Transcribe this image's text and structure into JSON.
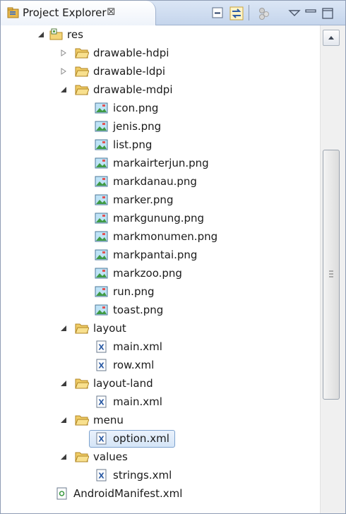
{
  "view": {
    "title": "Project Explorer",
    "close_glyph": "⊠",
    "toolbar": [
      "collapse-all-icon",
      "link-with-editor-icon",
      "focus-task-icon",
      "view-menu-icon",
      "minimize-icon",
      "maximize-icon"
    ]
  },
  "tree": {
    "res": "res",
    "drawable_hdpi": "drawable-hdpi",
    "drawable_ldpi": "drawable-ldpi",
    "drawable_mdpi": "drawable-mdpi",
    "files_mdpi": [
      "icon.png",
      "jenis.png",
      "list.png",
      "markairterjun.png",
      "markdanau.png",
      "marker.png",
      "markgunung.png",
      "markmonumen.png",
      "markpantai.png",
      "markzoo.png",
      "run.png",
      "toast.png"
    ],
    "layout": "layout",
    "layout_files": [
      "main.xml",
      "row.xml"
    ],
    "layout_land": "layout-land",
    "layout_land_files": [
      "main.xml"
    ],
    "menu": "menu",
    "menu_files": [
      "option.xml"
    ],
    "values": "values",
    "values_files": [
      "strings.xml"
    ],
    "manifest": "AndroidManifest.xml",
    "selected": "option.xml"
  },
  "colors": {
    "header_bg": "#c5d5ec",
    "folder": "#e8b84b",
    "selection_border": "#7da2ce"
  }
}
